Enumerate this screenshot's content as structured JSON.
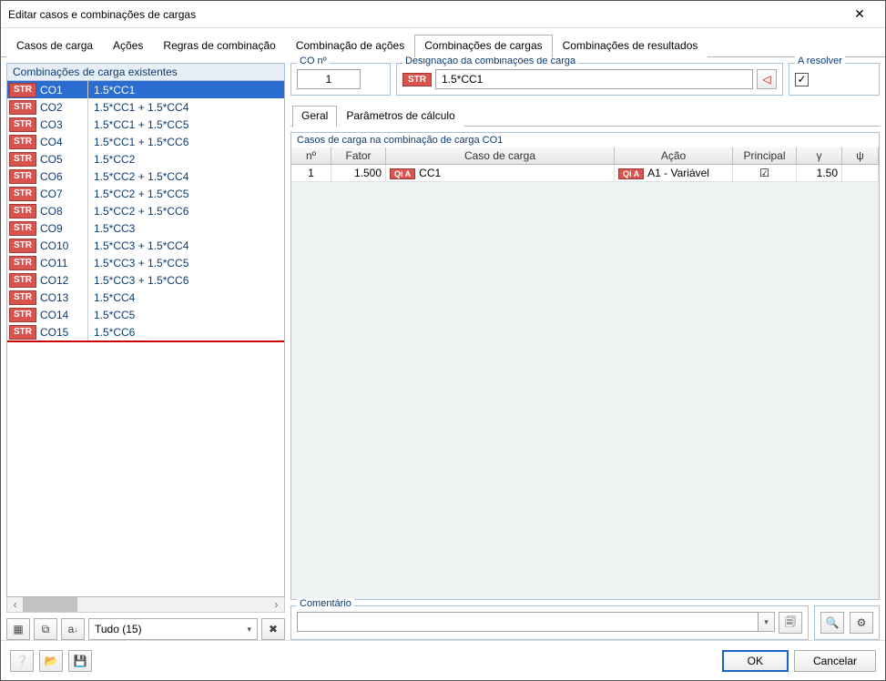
{
  "title": "Editar casos e combinações de cargas",
  "mainTabs": [
    "Casos de carga",
    "Ações",
    "Regras de combinação",
    "Combinação de ações",
    "Combinações de cargas",
    "Combinações de resultados"
  ],
  "activeMainTab": 4,
  "leftPane": {
    "header": "Combinações de carga existentes",
    "rows": [
      {
        "tag": "STR",
        "id": "CO1",
        "desc": "1.5*CC1",
        "selected": true
      },
      {
        "tag": "STR",
        "id": "CO2",
        "desc": "1.5*CC1 + 1.5*CC4"
      },
      {
        "tag": "STR",
        "id": "CO3",
        "desc": "1.5*CC1 + 1.5*CC5"
      },
      {
        "tag": "STR",
        "id": "CO4",
        "desc": "1.5*CC1 + 1.5*CC6"
      },
      {
        "tag": "STR",
        "id": "CO5",
        "desc": "1.5*CC2"
      },
      {
        "tag": "STR",
        "id": "CO6",
        "desc": "1.5*CC2 + 1.5*CC4"
      },
      {
        "tag": "STR",
        "id": "CO7",
        "desc": "1.5*CC2 + 1.5*CC5"
      },
      {
        "tag": "STR",
        "id": "CO8",
        "desc": "1.5*CC2 + 1.5*CC6"
      },
      {
        "tag": "STR",
        "id": "CO9",
        "desc": "1.5*CC3"
      },
      {
        "tag": "STR",
        "id": "CO10",
        "desc": "1.5*CC3 + 1.5*CC4"
      },
      {
        "tag": "STR",
        "id": "CO11",
        "desc": "1.5*CC3 + 1.5*CC5"
      },
      {
        "tag": "STR",
        "id": "CO12",
        "desc": "1.5*CC3 + 1.5*CC6"
      },
      {
        "tag": "STR",
        "id": "CO13",
        "desc": "1.5*CC4"
      },
      {
        "tag": "STR",
        "id": "CO14",
        "desc": "1.5*CC5"
      },
      {
        "tag": "STR",
        "id": "CO15",
        "desc": "1.5*CC6"
      }
    ],
    "filter": "Tudo (15)"
  },
  "rightPane": {
    "coLabel": "CO nº",
    "coValue": "1",
    "desigLabel": "Designação da combinações de carga",
    "desigTag": "STR",
    "desigValue": "1.5*CC1",
    "solveLabel": "A resolver",
    "solveChecked": true,
    "subTabs": [
      "Geral",
      "Parâmetros de cálculo"
    ],
    "activeSubTab": 0,
    "gridTitle": "Casos de carga na combinação de carga CO1",
    "cols": {
      "no": "nº",
      "fator": "Fator",
      "caso": "Caso de carga",
      "acao": "Ação",
      "princ": "Principal",
      "gamma": "γ",
      "psi": "ψ"
    },
    "gridRows": [
      {
        "no": "1",
        "fator": "1.500",
        "caseTag": "Qi A",
        "caseName": "CC1",
        "acaoTag": "Qi A",
        "acaoName": "A1 - Variável",
        "principal": true,
        "gamma": "1.50",
        "psi": ""
      }
    ],
    "commentLabel": "Comentário",
    "commentValue": ""
  },
  "footer": {
    "ok": "OK",
    "cancel": "Cancelar"
  }
}
